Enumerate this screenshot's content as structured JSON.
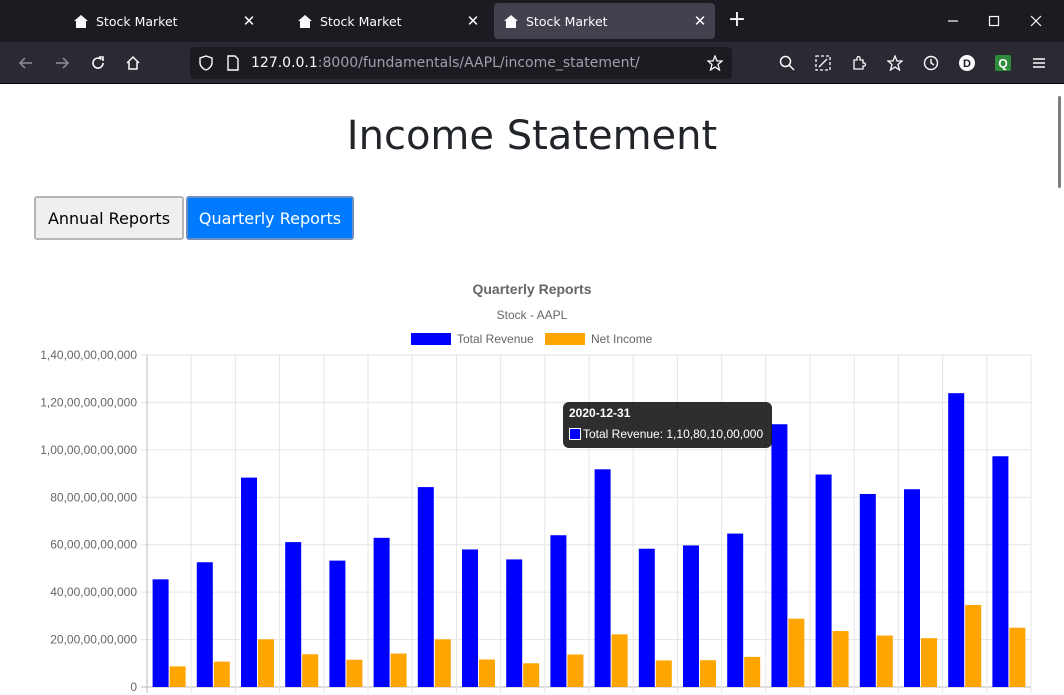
{
  "browser": {
    "tabs": [
      {
        "label": "Stock Market",
        "active": false
      },
      {
        "label": "Stock Market",
        "active": false
      },
      {
        "label": "Stock Market",
        "active": true
      }
    ],
    "url_host": "127.0.0.1",
    "url_rest": ":8000/fundamentals/AAPL/income_statement/",
    "profile_letter": "D",
    "extension_letter": "Q"
  },
  "page": {
    "title": "Income Statement",
    "annual_button": "Annual Reports",
    "quarterly_button": "Quarterly Reports"
  },
  "tooltip": {
    "title": "2020-12-31",
    "body": "Total Revenue: 1,10,80,10,00,000"
  },
  "colors": {
    "revenue": "#0000ff",
    "net_income": "#ffa500",
    "primary_button": "#007bff"
  },
  "chart_data": {
    "type": "bar",
    "title": "Quarterly Reports",
    "subtitle": "Stock - AAPL",
    "legend_position": "top",
    "grid": true,
    "ylim": [
      0,
      140000000000
    ],
    "y_ticks": [
      "0",
      "20,00,00,00,000",
      "40,00,00,00,000",
      "60,00,00,00,000",
      "80,00,00,00,000",
      "1,00,00,00,00,000",
      "1,20,00,00,00,000",
      "1,40,00,00,00,000"
    ],
    "y_tick_values": [
      0,
      20000000000,
      40000000000,
      60000000000,
      80000000000,
      100000000000,
      120000000000,
      140000000000
    ],
    "series": [
      {
        "name": "Total Revenue",
        "values": [
          45400000000,
          52600000000,
          88300000000,
          61100000000,
          53300000000,
          62900000000,
          84300000000,
          58000000000,
          53800000000,
          64000000000,
          91800000000,
          58300000000,
          59700000000,
          64700000000,
          110800000000,
          89600000000,
          81400000000,
          83400000000,
          123900000000,
          97300000000
        ]
      },
      {
        "name": "Net Income",
        "values": [
          8700000000,
          10700000000,
          20100000000,
          13800000000,
          11500000000,
          14100000000,
          20100000000,
          11600000000,
          10000000000,
          13700000000,
          22200000000,
          11200000000,
          11300000000,
          12700000000,
          28800000000,
          23600000000,
          21700000000,
          20600000000,
          34600000000,
          25000000000
        ]
      }
    ]
  }
}
